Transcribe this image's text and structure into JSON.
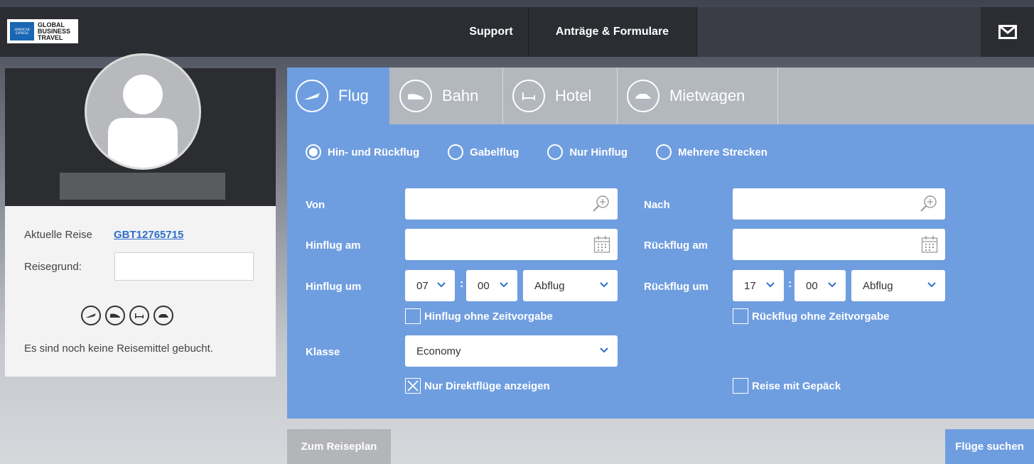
{
  "header": {
    "logo_text": [
      "GLOBAL",
      "BUSINESS",
      "TRAVEL"
    ],
    "logo_badge": "AMERICAN EXPRESS",
    "nav": [
      {
        "label": "Support"
      },
      {
        "label": "Anträge & Formulare"
      }
    ]
  },
  "sidebar": {
    "current_trip_label": "Aktuelle Reise",
    "current_trip_id": "GBT12765715",
    "reason_label": "Reisegrund:",
    "reason_value": "",
    "no_booking_text": "Es sind noch keine Reisemittel gebucht."
  },
  "tabs": [
    {
      "label": "Flug",
      "icon": "plane-icon",
      "active": true
    },
    {
      "label": "Bahn",
      "icon": "train-icon",
      "active": false
    },
    {
      "label": "Hotel",
      "icon": "hotel-bed-icon",
      "active": false
    },
    {
      "label": "Mietwagen",
      "icon": "car-icon",
      "active": false
    }
  ],
  "trip_types": [
    {
      "label": "Hin- und Rückflug",
      "selected": true
    },
    {
      "label": "Gabelflug",
      "selected": false
    },
    {
      "label": "Nur Hinflug",
      "selected": false
    },
    {
      "label": "Mehrere Strecken",
      "selected": false
    }
  ],
  "form": {
    "from_label": "Von",
    "from_value": "",
    "to_label": "Nach",
    "to_value": "",
    "depart_date_label": "Hinflug am",
    "depart_date_value": "",
    "return_date_label": "Rückflug am",
    "return_date_value": "",
    "depart_time_label": "Hinflug um",
    "depart_hour": "07",
    "depart_minute": "00",
    "depart_mode": "Abflug",
    "return_time_label": "Rückflug um",
    "return_hour": "17",
    "return_minute": "00",
    "return_mode": "Abflug",
    "time_separator": ":",
    "depart_no_time_label": "Hinflug ohne Zeitvorgabe",
    "depart_no_time_checked": false,
    "return_no_time_label": "Rückflug ohne Zeitvorgabe",
    "return_no_time_checked": false,
    "class_label": "Klasse",
    "class_value": "Economy",
    "direct_only_label": "Nur Direktflüge anzeigen",
    "direct_only_checked": true,
    "baggage_label": "Reise mit Gepäck",
    "baggage_checked": false
  },
  "actions": {
    "plan_label": "Zum Reiseplan",
    "search_label": "Flüge suchen"
  },
  "colors": {
    "accent_blue": "#6f9ee0",
    "topbar": "#2b2d33",
    "link": "#2f6fca"
  }
}
